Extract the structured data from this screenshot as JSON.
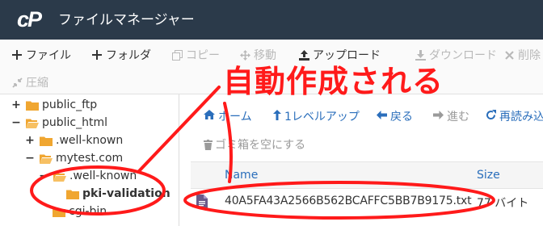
{
  "app": {
    "logo": "cP",
    "title": "ファイルマネージャー"
  },
  "toolbar": {
    "file": "ファイル",
    "folder": "フォルダ",
    "copy": "コピー",
    "move": "移動",
    "upload": "アップロード",
    "download": "ダウンロード",
    "delete": "削除",
    "compress": "圧縮"
  },
  "tree": {
    "items": [
      {
        "label": "public_ftp",
        "toggle": "+"
      },
      {
        "label": "public_html",
        "toggle": "−"
      },
      {
        "label": ".well-known",
        "toggle": "+"
      },
      {
        "label": "mytest.com",
        "toggle": "−"
      },
      {
        "label": ".well-known",
        "toggle": "−"
      },
      {
        "label": "pki-validation",
        "toggle": ""
      },
      {
        "label": "cgi-bin",
        "toggle": ""
      }
    ]
  },
  "nav": {
    "home": "ホーム",
    "up": "1レベルアップ",
    "back": "戻る",
    "forward": "進む",
    "reload": "再読み込み",
    "empty_trash": "ゴミ箱を空にする"
  },
  "table": {
    "col_name": "Name",
    "col_size": "Size",
    "rows": [
      {
        "name": "40A5FA43A2566B562BCAFFC5BB7B9175.txt",
        "size": "77 バイト"
      }
    ]
  },
  "annotation": {
    "text": "自動作成される",
    "color": "#ff1a1a"
  },
  "colors": {
    "header_bg": "#2b3a4a",
    "link": "#2a6ebb",
    "folder": "#f0a630"
  }
}
